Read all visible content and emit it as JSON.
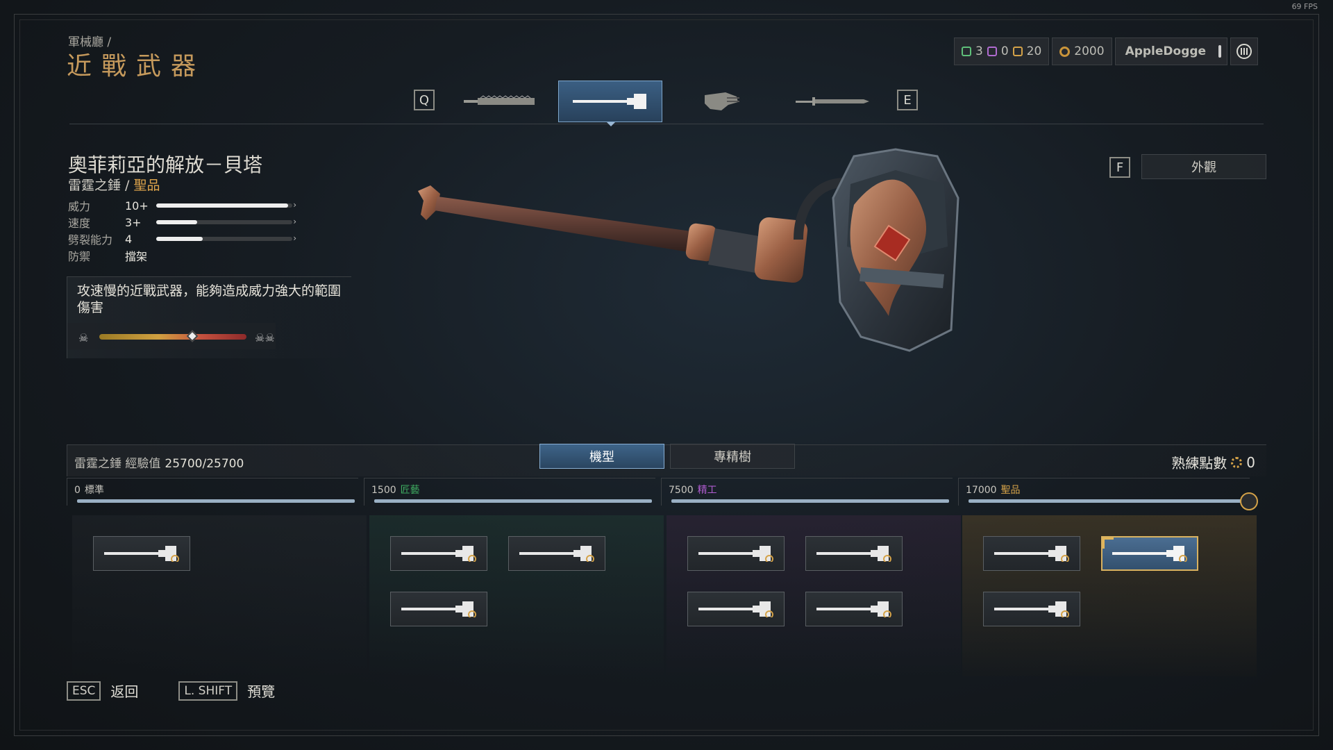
{
  "fps": "69 FPS",
  "header": {
    "breadcrumb": "軍械廳 /",
    "title": "近戰武器"
  },
  "currency": {
    "green": "3",
    "purple": "0",
    "gold_cube": "20",
    "coins": "2000",
    "username": "AppleDogge",
    "colors": {
      "green": "#5fbf7a",
      "purple": "#b06bd0",
      "gold": "#d4a248"
    }
  },
  "weapon_tabs": {
    "prev_key": "Q",
    "next_key": "E",
    "items": [
      "chainsword-icon",
      "thunder-hammer-icon",
      "power-fist-icon",
      "power-sword-icon"
    ],
    "active_index": 1
  },
  "weapon": {
    "name": "奧菲莉亞的解放－貝塔",
    "class": "雷霆之錘",
    "separator": " / ",
    "rarity": "聖品",
    "stats": [
      {
        "label": "威力",
        "value": "10+",
        "level": 0.97
      },
      {
        "label": "速度",
        "value": "3+",
        "level": 0.3
      },
      {
        "label": "劈裂能力",
        "value": "4",
        "level": 0.34
      },
      {
        "label": "防禦",
        "value": "擋架"
      }
    ],
    "description": "攻速慢的近戰武器，能夠造成威力強大的範圍傷害",
    "difficulty_level": 0.63
  },
  "actions": {
    "appearance_key": "F",
    "appearance_label": "外觀"
  },
  "progress": {
    "label": "雷霆之錘 經驗值",
    "xp": "25700/25700",
    "tabs": [
      "機型",
      "專精樹"
    ],
    "mastery_label": "熟練點數",
    "mastery_points": "0",
    "tiers": [
      {
        "threshold": "0",
        "rank": "標準",
        "color": "#c8c6bf"
      },
      {
        "threshold": "1500",
        "rank": "匠藝",
        "color": "#3fae62"
      },
      {
        "threshold": "7500",
        "rank": "精工",
        "color": "#b05cd0"
      },
      {
        "threshold": "17000",
        "rank": "聖品",
        "color": "#d4a248"
      }
    ]
  },
  "footer": {
    "back_key": "ESC",
    "back_label": "返回",
    "preview_key": "L. SHIFT",
    "preview_label": "預覽"
  }
}
